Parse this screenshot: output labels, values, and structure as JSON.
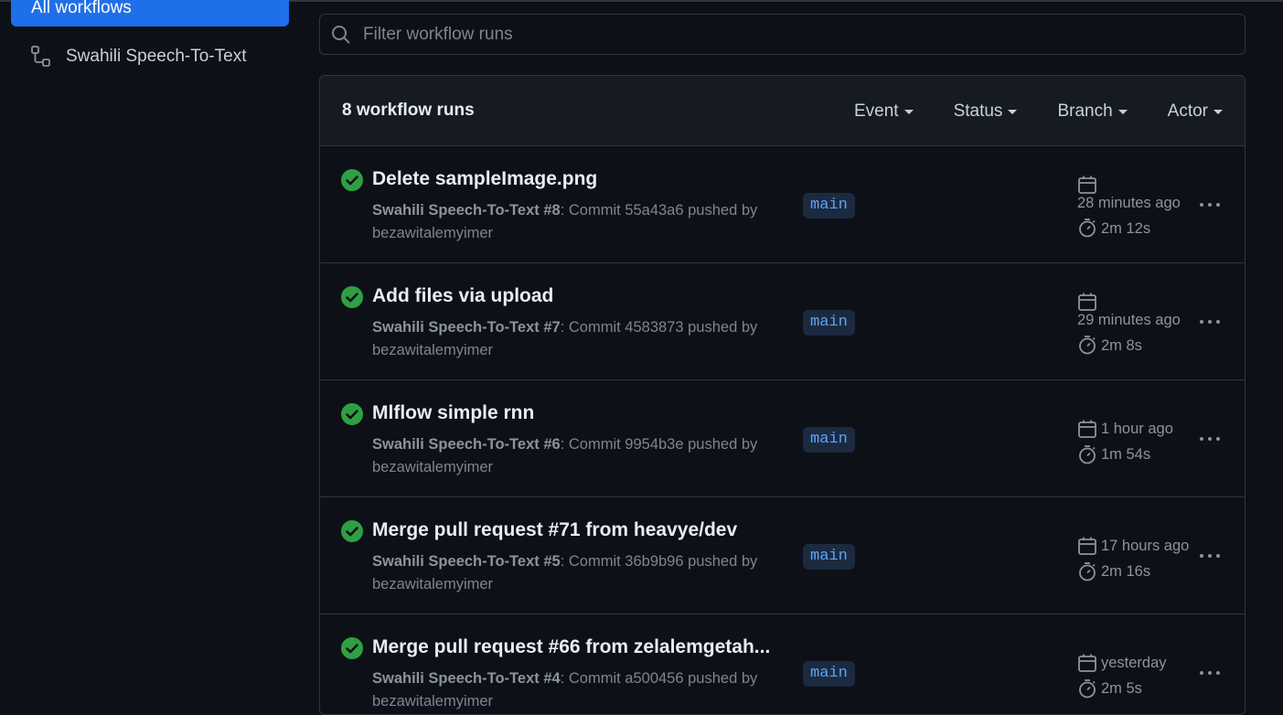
{
  "sidebar": {
    "active_item": "All workflows",
    "workflows": [
      {
        "label": "Swahili Speech-To-Text",
        "icon": "workflow-icon"
      }
    ]
  },
  "filter": {
    "placeholder": "Filter workflow runs",
    "value": ""
  },
  "runs": {
    "count_label": "8 workflow runs",
    "filters": [
      "Event",
      "Status",
      "Branch",
      "Actor"
    ],
    "items": [
      {
        "status": "success",
        "title": "Delete sampleImage.png",
        "workflow": "Swahili Speech-To-Text",
        "number": "#8",
        "description": ": Commit 55a43a6 pushed by bezawitalemyimer",
        "branch": "main",
        "when": "28 minutes ago",
        "duration": "2m 12s"
      },
      {
        "status": "success",
        "title": "Add files via upload",
        "workflow": "Swahili Speech-To-Text",
        "number": "#7",
        "description": ": Commit 4583873 pushed by bezawitalemyimer",
        "branch": "main",
        "when": "29 minutes ago",
        "duration": "2m 8s"
      },
      {
        "status": "success",
        "title": "Mlflow simple rnn",
        "workflow": "Swahili Speech-To-Text",
        "number": "#6",
        "description": ": Commit 9954b3e pushed by bezawitalemyimer",
        "branch": "main",
        "when": "1 hour ago",
        "duration": "1m 54s"
      },
      {
        "status": "success",
        "title": "Merge pull request #71 from heavye/dev",
        "workflow": "Swahili Speech-To-Text",
        "number": "#5",
        "description": ": Commit 36b9b96 pushed by bezawitalemyimer",
        "branch": "main",
        "when": "17 hours ago",
        "duration": "2m 16s"
      },
      {
        "status": "success",
        "title": "Merge pull request #66 from zelalemgetah...",
        "workflow": "Swahili Speech-To-Text",
        "number": "#4",
        "description": ": Commit a500456 pushed by bezawitalemyimer",
        "branch": "main",
        "when": "yesterday",
        "duration": "2m 5s"
      }
    ]
  },
  "colors": {
    "background": "#0d1117",
    "accent": "#1f6feb",
    "success": "#2ea043",
    "branch_text": "#58a6ff",
    "branch_bg": "#1c2a3f",
    "border": "#30363d"
  }
}
